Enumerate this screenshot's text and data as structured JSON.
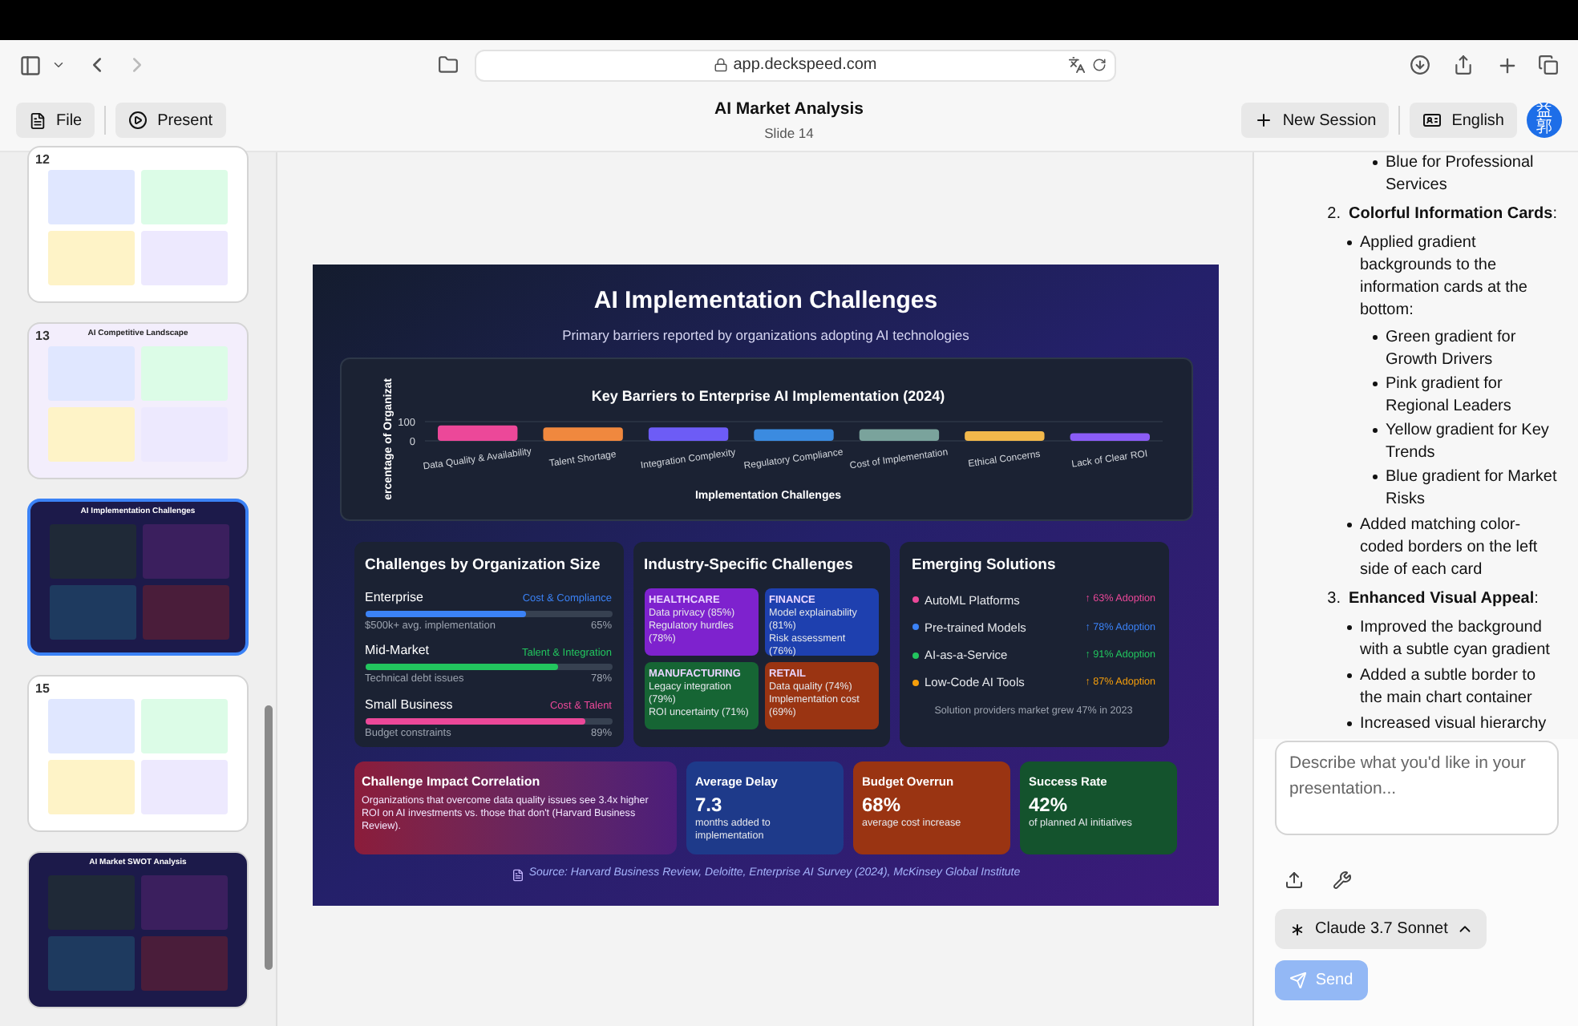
{
  "browser": {
    "url": "app.deckspeed.com"
  },
  "app_bar": {
    "file_button": "File",
    "present_button": "Present",
    "title": "AI Market Analysis",
    "subtitle": "Slide 14",
    "new_session_button": "New Session",
    "language_button": "English",
    "avatar": "益郭"
  },
  "thumbnails": [
    {
      "number": "12",
      "kind": "light",
      "selected": false
    },
    {
      "number": "13",
      "title": "AI Competitive Landscape",
      "kind": "tinted",
      "selected": false
    },
    {
      "title": "AI Implementation Challenges",
      "kind": "dark",
      "selected": true
    },
    {
      "number": "15",
      "kind": "light",
      "selected": false
    },
    {
      "title": "AI Market SWOT Analysis",
      "kind": "dark",
      "selected": false
    }
  ],
  "slide": {
    "title": "AI Implementation Challenges",
    "subtitle": "Primary barriers reported by organizations adopting AI technologies",
    "chart": {
      "chart_data": {
        "type": "bar",
        "title": "Key Barriers to Enterprise AI Implementation (2024)",
        "xlabel": "Implementation Challenges",
        "ylabel": "ercentage of Organizat",
        "categories": [
          "Data Quality & Availability",
          "Talent Shortage",
          "Integration Complexity",
          "Regulatory Compliance",
          "Cost of Implementation",
          "Ethical Concerns",
          "Lack of Clear ROI"
        ],
        "values": [
          80,
          70,
          70,
          60,
          60,
          50,
          40
        ],
        "colors": [
          "#ec4899",
          "#f0883e",
          "#6d5cf6",
          "#3b8be0",
          "#7aa39c",
          "#f2b84b",
          "#8b5cf6"
        ],
        "ylim": [
          0,
          100
        ],
        "yticks": [
          0,
          100
        ]
      }
    },
    "org_size": {
      "title": "Challenges by Organization Size",
      "rows": [
        {
          "name": "Enterprise",
          "tag": "Cost & Compliance",
          "color": "#3b82f6",
          "level": 0.65,
          "note": "$500k+ avg. implementation",
          "value": "65%"
        },
        {
          "name": "Mid-Market",
          "tag": "Talent & Integration",
          "color": "#22c55e",
          "level": 0.78,
          "note": "Technical debt issues",
          "value": "78%"
        },
        {
          "name": "Small Business",
          "tag": "Cost & Talent",
          "color": "#ec4899",
          "level": 0.89,
          "note": "Budget constraints",
          "value": "89%"
        }
      ]
    },
    "industry": {
      "title": "Industry-Specific Challenges",
      "cards": [
        {
          "name": "HEALTHCARE",
          "color": "#7e22ce",
          "lines": [
            "Data privacy (85%)",
            "Regulatory hurdles (78%)"
          ]
        },
        {
          "name": "FINANCE",
          "color": "#1e40af",
          "lines": [
            "Model explainability (81%)",
            "Risk assessment (76%)"
          ]
        },
        {
          "name": "MANUFACTURING",
          "color": "#166534",
          "lines": [
            "Legacy integration (79%)",
            "ROI uncertainty (71%)"
          ]
        },
        {
          "name": "RETAIL",
          "color": "#9a3412",
          "lines": [
            "Data quality (74%)",
            "Implementation cost (69%)"
          ]
        }
      ]
    },
    "solutions": {
      "title": "Emerging Solutions",
      "items": [
        {
          "name": "AutoML Platforms",
          "color": "#ec4899",
          "trend": "↑ 63% Adoption"
        },
        {
          "name": "Pre-trained Models",
          "color": "#3b82f6",
          "trend": "↑ 78% Adoption"
        },
        {
          "name": "AI-as-a-Service",
          "color": "#22c55e",
          "trend": "↑ 91% Adoption"
        },
        {
          "name": "Low-Code AI Tools",
          "color": "#f59e0b",
          "trend": "↑ 87% Adoption"
        }
      ],
      "footer": "Solution providers market grew 47% in 2023"
    },
    "correlation": {
      "title": "Challenge Impact Correlation",
      "text": "Organizations that overcome data quality issues see 3.4x higher ROI on AI investments vs. those that don't (Harvard Business Review)."
    },
    "stats": [
      {
        "title": "Average Delay",
        "value": "7.3",
        "caption": "months added to implementation",
        "color": "#1e3a8a"
      },
      {
        "title": "Budget Overrun",
        "value": "68%",
        "caption": "average cost increase",
        "color": "#9a3412"
      },
      {
        "title": "Success Rate",
        "value": "42%",
        "caption": "of planned AI initiatives",
        "color": "#14532d"
      }
    ],
    "source": "Source: Harvard Business Review, Deloitte, Enterprise AI Survey (2024), McKinsey Global Institute"
  },
  "chat": {
    "items": [
      {
        "kind": "bullet",
        "text": "Blue for Professional Services"
      },
      {
        "kind": "numbered",
        "number": "2.",
        "text": "**Colorful Information Cards**:",
        "children": [
          {
            "text": "Applied gradient backgrounds to the information cards at the bottom:",
            "children": [
              {
                "text": "Green gradient for Growth Drivers"
              },
              {
                "text": "Pink gradient for Regional Leaders"
              },
              {
                "text": "Yellow gradient for Key Trends"
              },
              {
                "text": "Blue gradient for Market Risks"
              }
            ]
          },
          {
            "text": "Added matching color-coded borders on the left side of each card"
          }
        ]
      },
      {
        "kind": "numbered",
        "number": "3.",
        "text": "**Enhanced Visual Appeal**:",
        "children": [
          {
            "text": "Improved the background with a subtle cyan gradient"
          },
          {
            "text": "Added a subtle border to the main chart container"
          },
          {
            "text": "Increased visual hierarchy"
          }
        ]
      }
    ],
    "input": {
      "placeholder": "Describe what you'd like in your presentation..."
    },
    "model_button": "Claude 3.7 Sonnet",
    "send_button": {
      "label": "Send",
      "disabled": true
    }
  }
}
